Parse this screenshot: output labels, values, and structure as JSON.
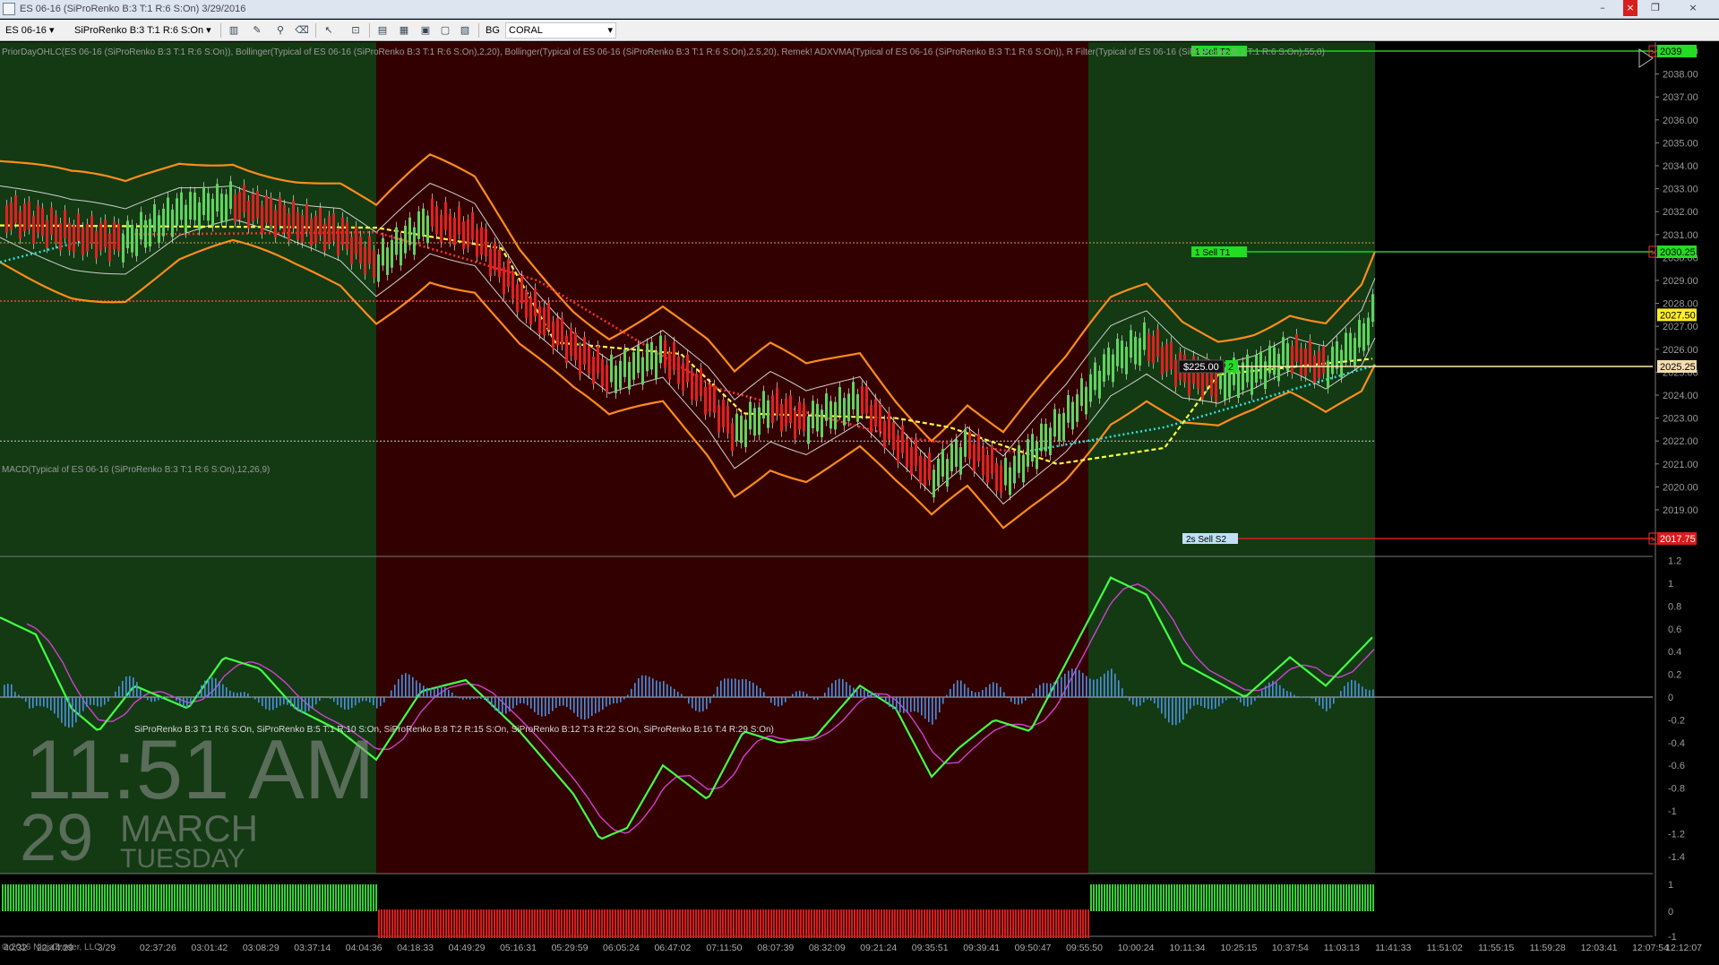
{
  "window": {
    "title": "ES 06-16 (SiProRenko B:3 T:1 R:6 S:On)  3/29/2016",
    "minimize": "–",
    "close": "×",
    "restore": "❐",
    "menu": "▾"
  },
  "toolbar": {
    "instrument": "ES 06-16",
    "bar_type": "SiProRenko B:3 T:1 R:6 S:On",
    "bg_label": "BG",
    "bg_value": "CORAL"
  },
  "colors": {
    "bg_green": "#133a13",
    "bg_red": "#330000",
    "candle_up": "#5fd35f",
    "candle_down": "#e02020",
    "bollinger_outer": "#ff8c1a",
    "bollinger_inner": "#cfcfcf",
    "macd_line": "#44ff44",
    "signal_line": "#d040d0",
    "histogram": "#4a90e0"
  },
  "price_panel": {
    "indicator_label": "PriorDayOHLC(ES 06-16 (SiProRenko B:3 T:1 R:6 S:On)), Bollinger(Typical of ES 06-16 (SiProRenko B:3 T:1 R:6 S:On),2,20), Bollinger(Typical of ES 06-16 (SiProRenko B:3 T:1 R:6 S:On),2.5,20), Remek! ADXVMA(Typical of ES 06-16 (SiProRenko B:3 T:1 R:6 S:On)), R                    Filter(Typical of ES 06-16 (SiProRenko B:3 T:1 R:6 S:On),55,0)",
    "price_ticks": [
      "2039.00",
      "2038.00",
      "2037.00",
      "2036.00",
      "2035.00",
      "2034.00",
      "2033.00",
      "2032.00",
      "2031.00",
      "2030.00",
      "2029.00",
      "2028.00",
      "2027.00",
      "2026.00",
      "2025.00",
      "2024.00",
      "2023.00",
      "2022.00",
      "2021.00",
      "2020.00",
      "2019.00"
    ],
    "price_markers": [
      "2039",
      "2030.25",
      "2027.50",
      "2025.25",
      "2017.75"
    ],
    "order_labels": [
      {
        "text": "1  Sell T2"
      },
      {
        "text": "1  Sell T1"
      },
      {
        "text": "2s  Sell S2"
      }
    ],
    "position_pnl": "$225.00",
    "position_qty": "2"
  },
  "macd_panel": {
    "label": "MACD(Typical of ES 06-16 (SiProRenko B:3 T:1 R:6 S:On),12,26,9)",
    "ticks": [
      "1.2",
      "1",
      "0.8",
      "0.6",
      "0.4",
      "0.2",
      "0",
      "-0.2",
      "-0.4",
      "-0.6",
      "-0.8",
      "-1",
      "-1.2",
      "-1.4"
    ]
  },
  "trend_panel": {
    "label": "SiProRenko B:3 T:1 R:6 S:On, SiProRenko B:5 T:1 R:10 S:On, SiProRenko B:8 T:2 R:15 S:On, SiProRenko B:12 T:3 R:22 S:On, SiProRenko B:16 T:4 R:29 S:On)",
    "ticks": [
      "1",
      "0",
      "-1"
    ]
  },
  "time_axis": [
    "40:32",
    "22:44:29",
    "3/29",
    "02:37:26",
    "03:01:42",
    "03:08:29",
    "03:37:14",
    "04:04:36",
    "04:18:33",
    "04:49:29",
    "05:16:31",
    "05:29:59",
    "06:05:24",
    "06:47:02",
    "07:11:50",
    "08:07:39",
    "08:32:09",
    "09:21:24",
    "09:35:51",
    "09:39:41",
    "09:50:47",
    "09:55:50",
    "10:00:24",
    "10:11:34",
    "10:25:15",
    "10:37:54",
    "11:03:13",
    "11:41:33",
    "11:51:02",
    "11:55:15",
    "11:59:28",
    "12:03:41",
    "12:07:54",
    "12:12:07"
  ],
  "clock": {
    "time": "11:51 AM",
    "day": "29",
    "month": "MARCH",
    "weekday": "TUESDAY"
  },
  "copyright": "© 2016 NinjaTrader, LLC"
}
